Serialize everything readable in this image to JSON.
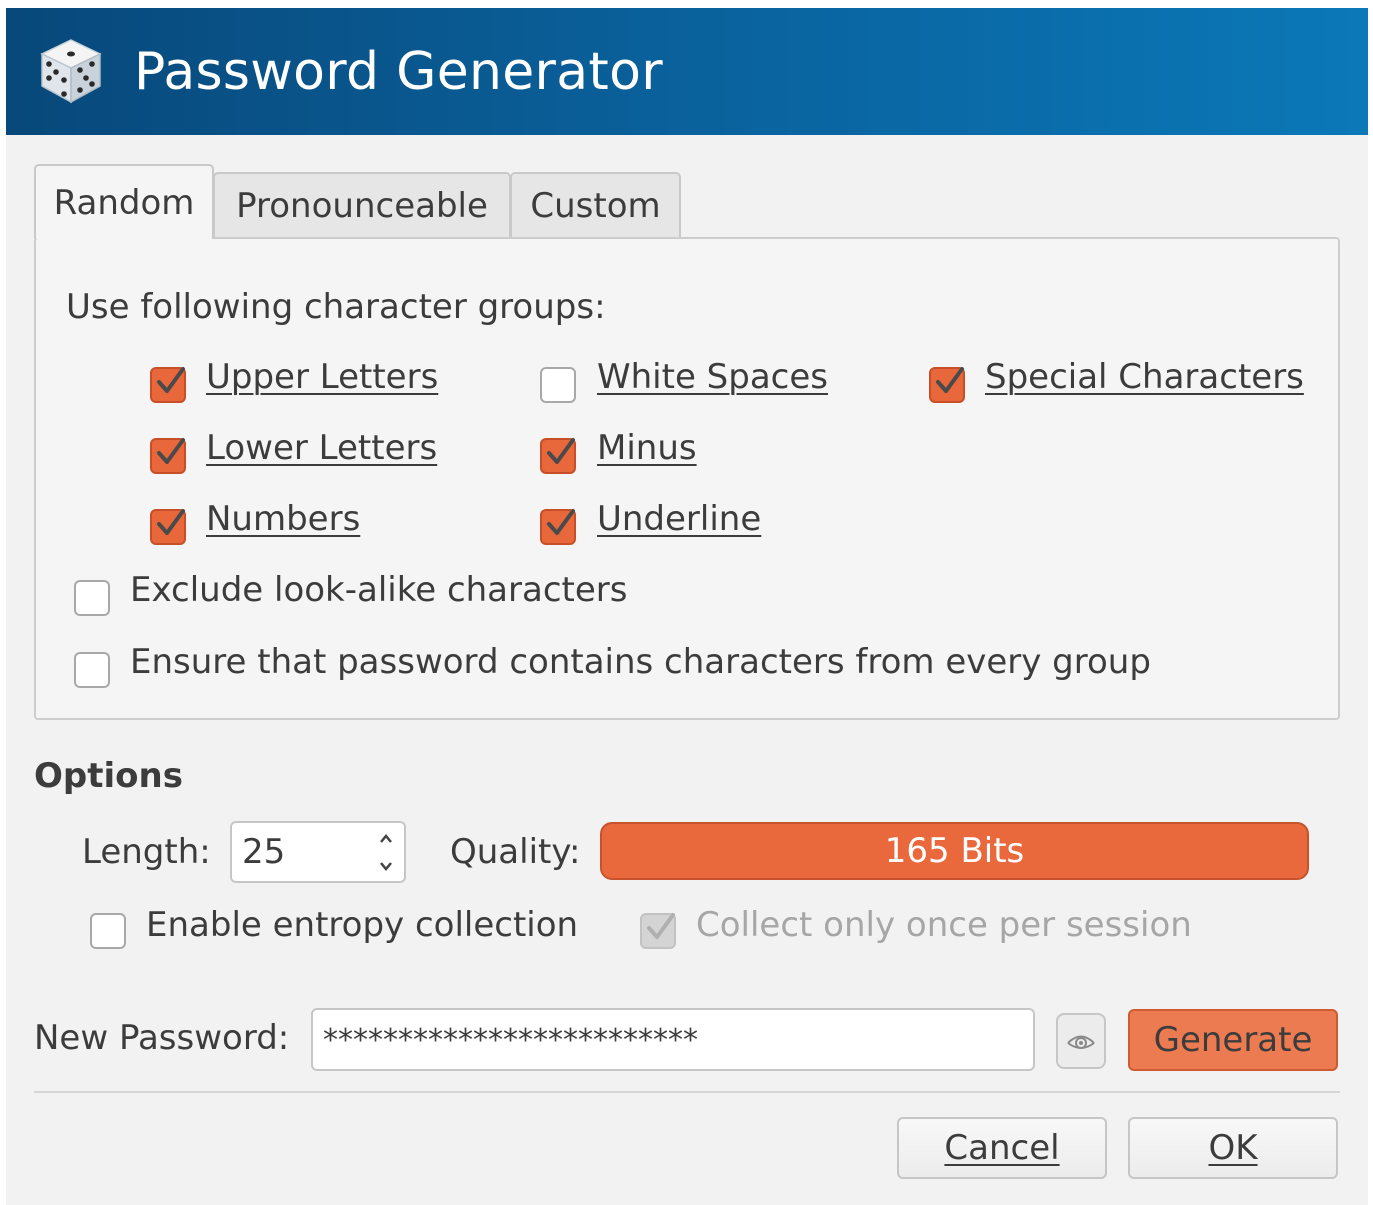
{
  "window": {
    "title": "Password Generator"
  },
  "tabs": [
    {
      "label": "Random",
      "active": true
    },
    {
      "label": "Pronounceable",
      "active": false
    },
    {
      "label": "Custom",
      "active": false
    }
  ],
  "random": {
    "heading": "Use following character groups:",
    "groups": {
      "upper_letters": {
        "label": "Upper Letters",
        "checked": true
      },
      "lower_letters": {
        "label": "Lower Letters",
        "checked": true
      },
      "numbers": {
        "label": "Numbers",
        "checked": true
      },
      "white_spaces": {
        "label": "White Spaces",
        "checked": false
      },
      "minus": {
        "label": "Minus",
        "checked": true
      },
      "underline": {
        "label": "Underline",
        "checked": true
      },
      "special_characters": {
        "label": "Special Characters",
        "checked": true
      }
    },
    "exclude_lookalike": {
      "label": "Exclude look-alike characters",
      "checked": false
    },
    "ensure_every_group": {
      "label": "Ensure that password contains characters from every group",
      "checked": false
    }
  },
  "options": {
    "heading": "Options",
    "length_label": "Length:",
    "length_value": "25",
    "quality_label": "Quality:",
    "quality_text": "165 Bits",
    "quality_fill_fraction": 1.0,
    "entropy": {
      "label": "Enable entropy collection",
      "checked": false
    },
    "collect_once": {
      "label": "Collect only once per session",
      "checked": true,
      "disabled": true
    }
  },
  "new_password": {
    "label": "New Password:",
    "value": "*************************",
    "generate_label": "Generate"
  },
  "buttons": {
    "cancel": "Cancel",
    "ok": "OK"
  },
  "colors": {
    "titlebar": "#0a5f99",
    "accent": "#e8673b",
    "quality_bar": "#e9693c"
  }
}
